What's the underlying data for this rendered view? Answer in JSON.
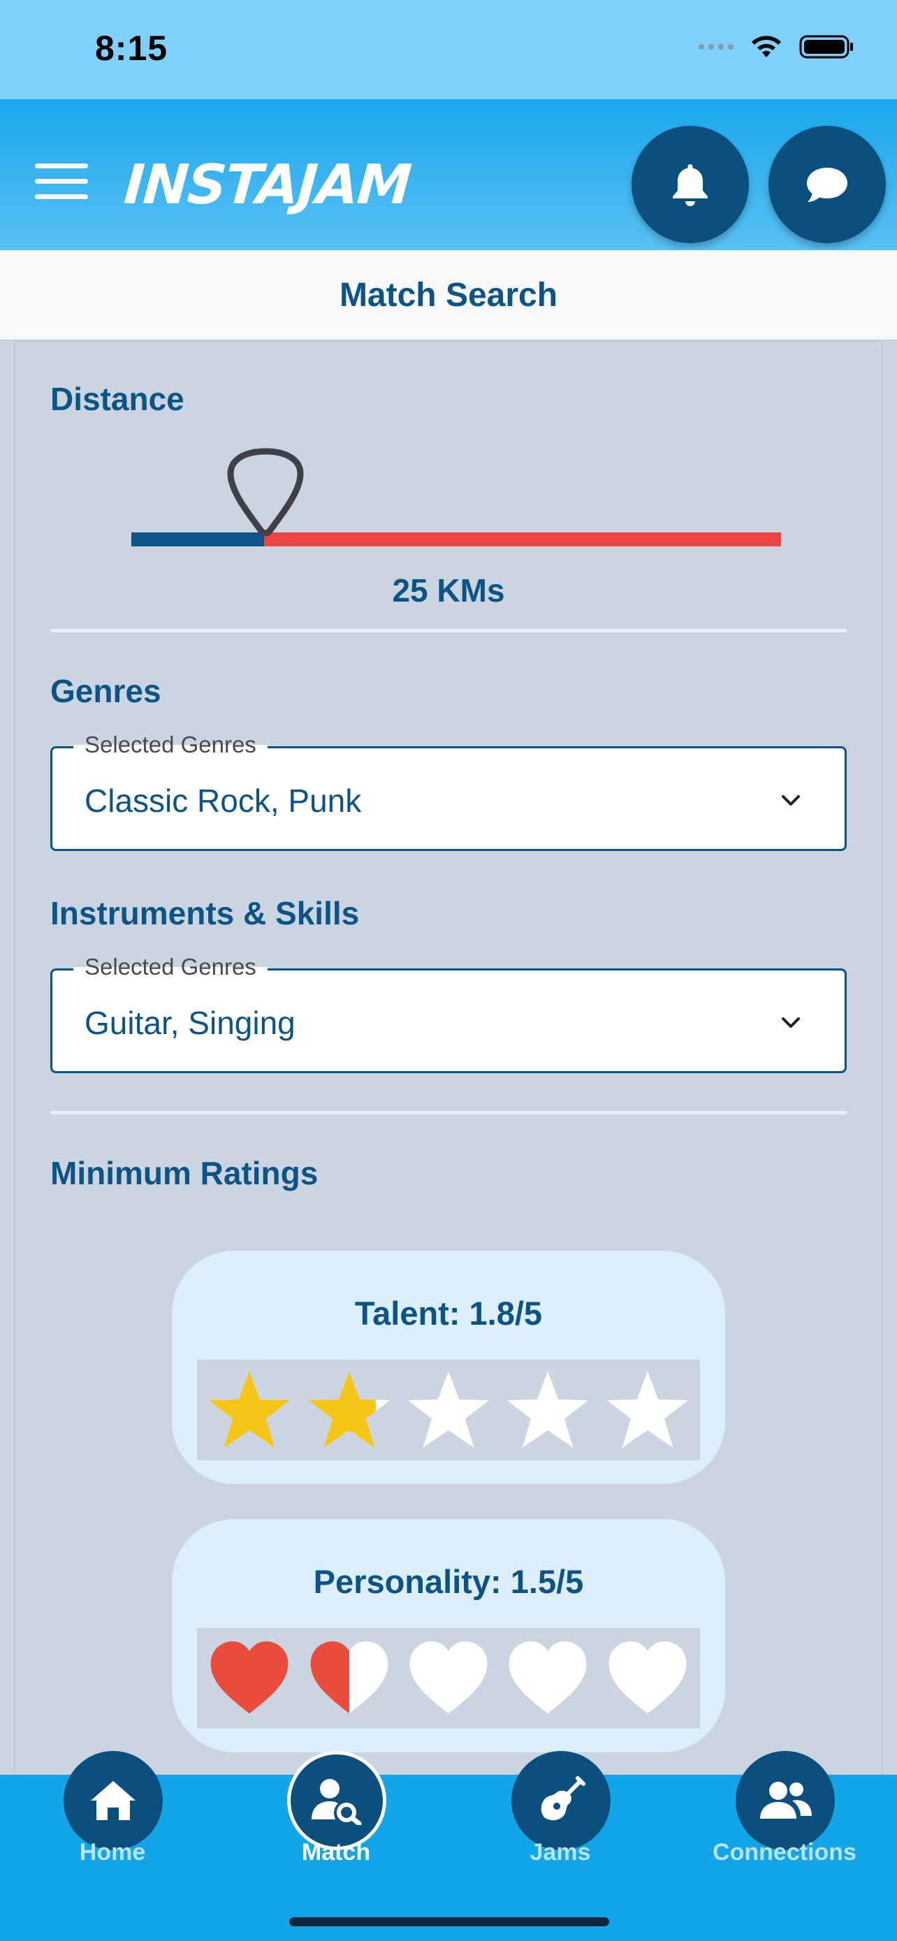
{
  "status_bar": {
    "time": "8:15"
  },
  "header": {
    "logo": "INSTAJAM",
    "notifications_icon": "bell-icon",
    "messages_icon": "chat-bubble-icon",
    "menu_icon": "hamburger-menu-icon"
  },
  "page": {
    "title": "Match Search"
  },
  "distance": {
    "title": "Distance",
    "value_label": "25 KMs",
    "slider_fraction": 0.2,
    "thumb_icon": "guitar-pick-icon",
    "colors": {
      "filled": "#0d5486",
      "remaining": "#ef4444"
    }
  },
  "genres": {
    "title": "Genres",
    "field_label": "Selected Genres",
    "value": "Classic Rock, Punk"
  },
  "instruments": {
    "title": "Instruments & Skills",
    "field_label": "Selected Genres",
    "value": "Guitar, Singing"
  },
  "ratings": {
    "title": "Minimum Ratings",
    "talent": {
      "label": "Talent: 1.8/5",
      "value": 1.8,
      "max": 5,
      "icon": "star-icon",
      "color": "#f5c518"
    },
    "personality": {
      "label": "Personality: 1.5/5",
      "value": 1.5,
      "max": 5,
      "icon": "heart-icon",
      "color": "#e74c3c"
    }
  },
  "bottom_nav": {
    "items": [
      {
        "label": "Home",
        "icon": "home-icon"
      },
      {
        "label": "Match",
        "icon": "user-search-icon",
        "active": true
      },
      {
        "label": "Jams",
        "icon": "guitar-icon"
      },
      {
        "label": "Connections",
        "icon": "users-icon"
      }
    ]
  }
}
